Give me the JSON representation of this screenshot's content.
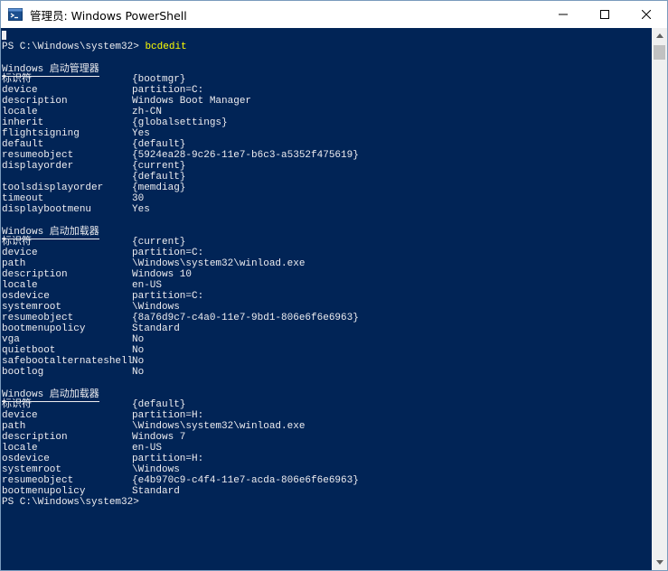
{
  "window": {
    "title": "管理员: Windows PowerShell",
    "icon": "powershell-icon",
    "controls": [
      "minimize-icon",
      "maximize-icon",
      "close-icon"
    ]
  },
  "colors": {
    "console_bg": "#012456",
    "console_fg": "#eeedf0",
    "command": "#ffff00"
  },
  "console": {
    "prompt": "PS C:\\Windows\\system32> ",
    "command": "bcdedit",
    "sections": [
      {
        "header": "Windows 启动管理器",
        "entries": [
          {
            "key": "标识符",
            "value": "{bootmgr}"
          },
          {
            "key": "device",
            "value": "partition=C:"
          },
          {
            "key": "description",
            "value": "Windows Boot Manager"
          },
          {
            "key": "locale",
            "value": "zh-CN"
          },
          {
            "key": "inherit",
            "value": "{globalsettings}"
          },
          {
            "key": "flightsigning",
            "value": "Yes"
          },
          {
            "key": "default",
            "value": "{default}"
          },
          {
            "key": "resumeobject",
            "value": "{5924ea28-9c26-11e7-b6c3-a5352f475619}"
          },
          {
            "key": "displayorder",
            "value": "{current}"
          },
          {
            "key": "",
            "value": "{default}"
          },
          {
            "key": "toolsdisplayorder",
            "value": "{memdiag}"
          },
          {
            "key": "timeout",
            "value": "30"
          },
          {
            "key": "displaybootmenu",
            "value": "Yes"
          }
        ]
      },
      {
        "header": "Windows 启动加载器",
        "entries": [
          {
            "key": "标识符",
            "value": "{current}"
          },
          {
            "key": "device",
            "value": "partition=C:"
          },
          {
            "key": "path",
            "value": "\\Windows\\system32\\winload.exe"
          },
          {
            "key": "description",
            "value": "Windows 10"
          },
          {
            "key": "locale",
            "value": "en-US"
          },
          {
            "key": "osdevice",
            "value": "partition=C:"
          },
          {
            "key": "systemroot",
            "value": "\\Windows"
          },
          {
            "key": "resumeobject",
            "value": "{8a76d9c7-c4a0-11e7-9bd1-806e6f6e6963}"
          },
          {
            "key": "bootmenupolicy",
            "value": "Standard"
          },
          {
            "key": "vga",
            "value": "No"
          },
          {
            "key": "quietboot",
            "value": "No"
          },
          {
            "key": "safebootalternateshell",
            "value": "No"
          },
          {
            "key": "bootlog",
            "value": "No"
          }
        ]
      },
      {
        "header": "Windows 启动加载器",
        "entries": [
          {
            "key": "标识符",
            "value": "{default}"
          },
          {
            "key": "device",
            "value": "partition=H:"
          },
          {
            "key": "path",
            "value": "\\Windows\\system32\\winload.exe"
          },
          {
            "key": "description",
            "value": "Windows 7"
          },
          {
            "key": "locale",
            "value": "en-US"
          },
          {
            "key": "osdevice",
            "value": "partition=H:"
          },
          {
            "key": "systemroot",
            "value": "\\Windows"
          },
          {
            "key": "resumeobject",
            "value": "{e4b970c9-c4f4-11e7-acda-806e6f6e6963}"
          },
          {
            "key": "bootmenupolicy",
            "value": "Standard"
          }
        ]
      }
    ],
    "final_prompt": "PS C:\\Windows\\system32>"
  }
}
